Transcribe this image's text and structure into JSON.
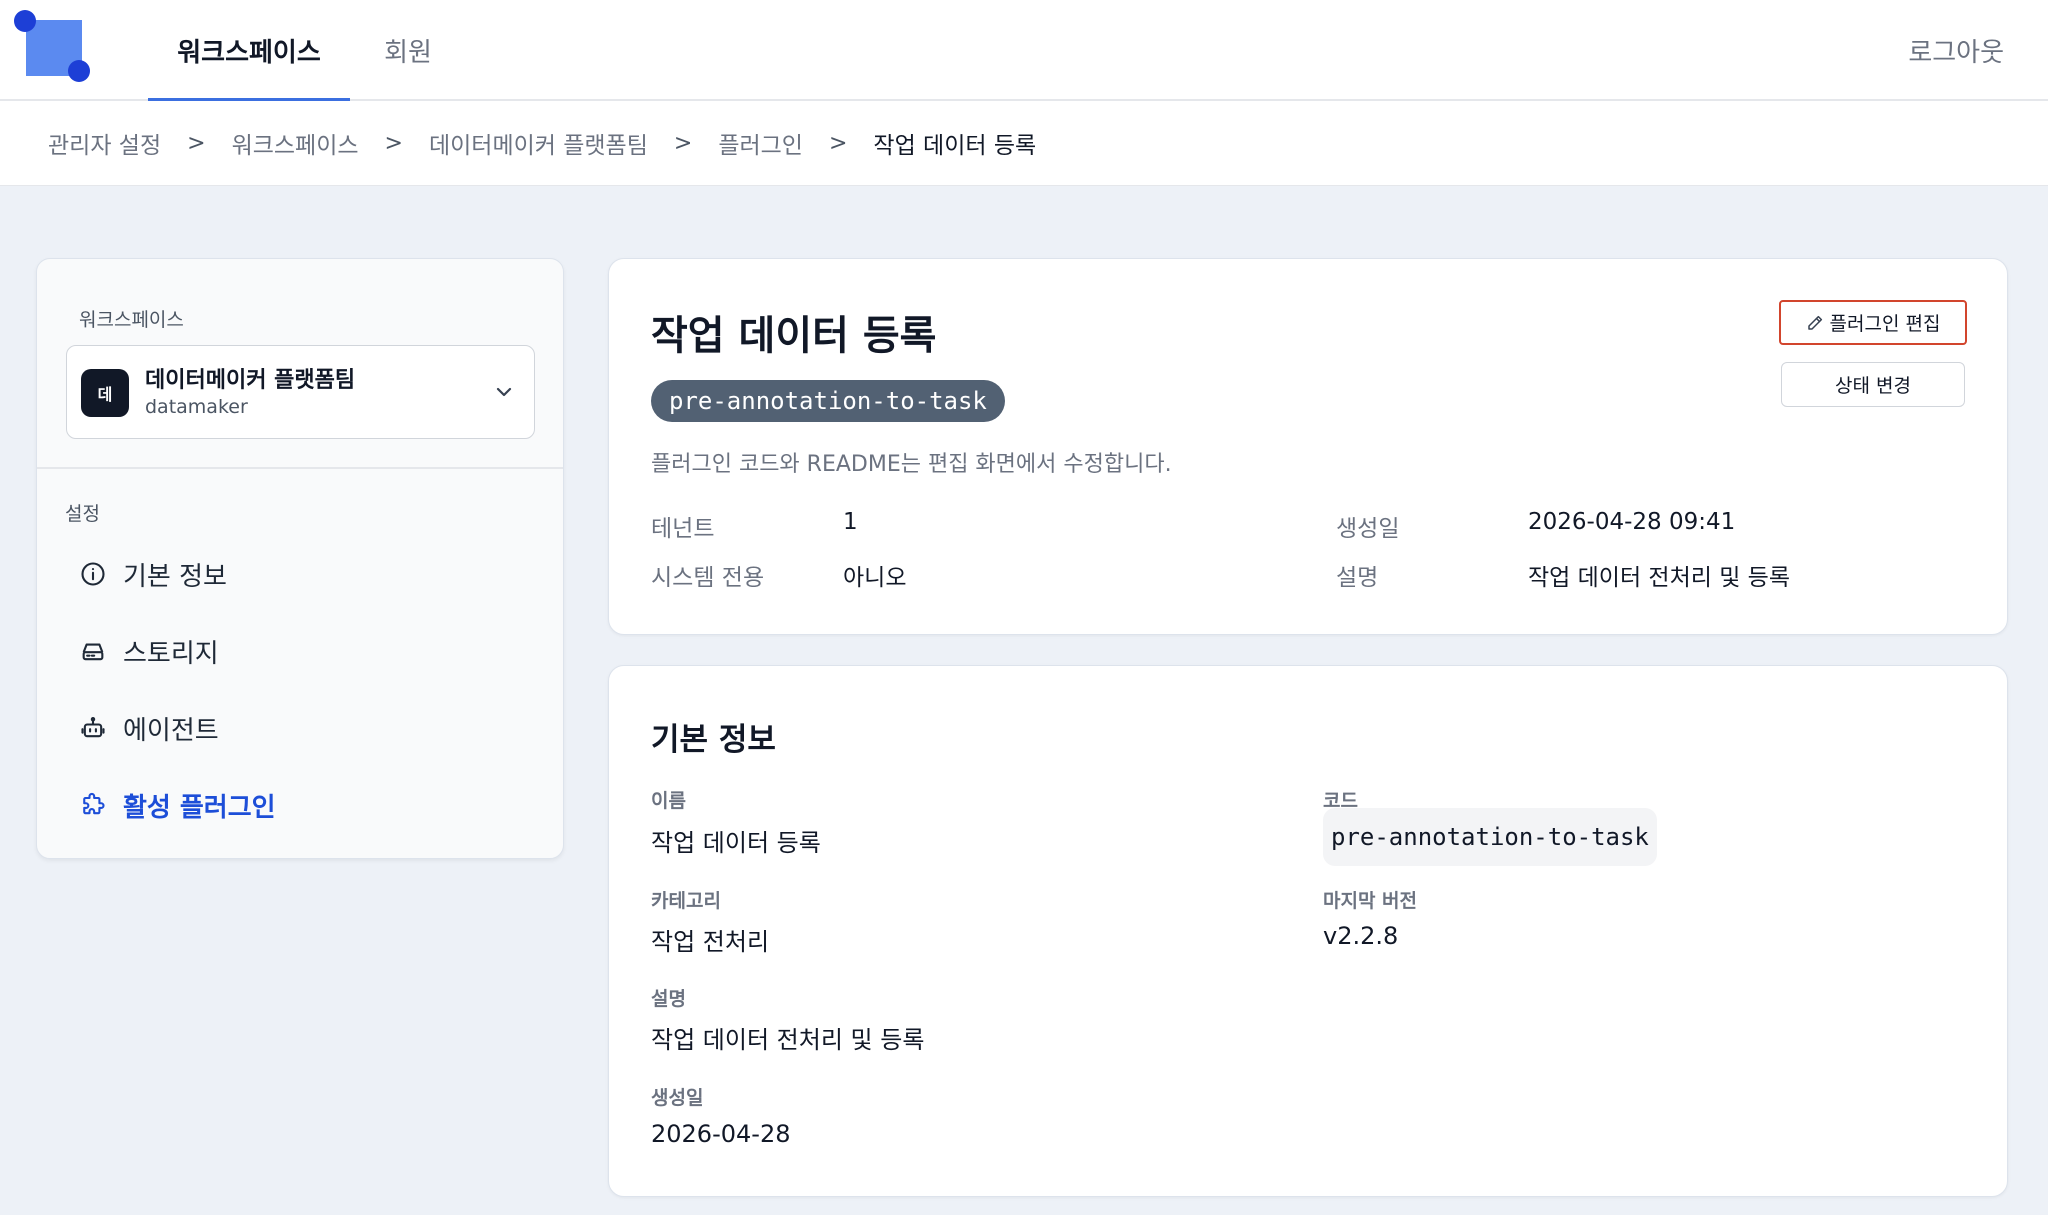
{
  "nav": {
    "tabs": [
      {
        "label": "워크스페이스",
        "active": true
      },
      {
        "label": "회원",
        "active": false
      }
    ],
    "logout_label": "로그아웃"
  },
  "breadcrumb": [
    "관리자 설정",
    "워크스페이스",
    "데이터메이커 플랫폼팀",
    "플러그인",
    "작업 데이터 등록"
  ],
  "breadcrumb_separator": ">",
  "sidebar": {
    "workspace_label": "워크스페이스",
    "workspace": {
      "avatar": "데",
      "name": "데이터메이커 플랫폼팀",
      "slug": "datamaker"
    },
    "settings_label": "설정",
    "items": [
      {
        "label": "기본 정보",
        "icon": "info-circle-icon"
      },
      {
        "label": "스토리지",
        "icon": "storage-drive-icon"
      },
      {
        "label": "에이전트",
        "icon": "robot-icon"
      },
      {
        "label": "활성 플러그인",
        "icon": "puzzle-icon",
        "active": true
      }
    ]
  },
  "header": {
    "title": "작업 데이터 등록",
    "code": "pre-annotation-to-task",
    "subtitle": "플러그인 코드와 README는 편집 화면에서 수정합니다.",
    "edit_button": "플러그인 편집",
    "status_button": "상태 변경",
    "meta": [
      {
        "label": "테넌트",
        "value": "1"
      },
      {
        "label": "시스템 전용",
        "value": "아니오"
      },
      {
        "label": "생성일",
        "value": "2026-04-28 09:41"
      },
      {
        "label": "설명",
        "value": "작업 데이터 전처리 및 등록"
      }
    ]
  },
  "basic_info": {
    "title": "기본 정보",
    "fields": {
      "name": {
        "label": "이름",
        "value": "작업 데이터 등록"
      },
      "code": {
        "label": "코드",
        "value": "pre-annotation-to-task"
      },
      "category": {
        "label": "카테고리",
        "value": "작업 전처리"
      },
      "latest_version": {
        "label": "마지막 버전",
        "value": "v2.2.8"
      },
      "description": {
        "label": "설명",
        "value": "작업 데이터 전처리 및 등록"
      },
      "created": {
        "label": "생성일",
        "value": "2026-04-28"
      }
    }
  },
  "colors": {
    "accent": "#1d4ed8",
    "highlight_border": "#d2452d",
    "code_pill": "#526173"
  }
}
